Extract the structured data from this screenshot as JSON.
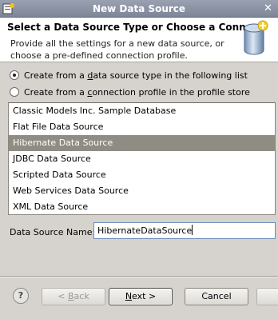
{
  "window": {
    "title": "New Data Source"
  },
  "header": {
    "title": "Select a Data Source Type or Choose a Connec",
    "description": "Provide all the settings for a new data source, or choose a pre-defined connection profile."
  },
  "options": {
    "opt1": {
      "pre": "Create from a ",
      "mnemonic": "d",
      "post": "ata source type in the following list",
      "selected": true
    },
    "opt2": {
      "pre": "Create from a ",
      "mnemonic": "c",
      "post": "onnection profile in the profile store",
      "selected": false
    }
  },
  "data_source_types": [
    "Classic Models Inc. Sample Database",
    "Flat File Data Source",
    "Hibernate Data Source",
    "JDBC Data Source",
    "Scripted Data Source",
    "Web Services Data Source",
    "XML Data Source"
  ],
  "selected_index": 2,
  "name_field": {
    "label": "Data Source Name:",
    "value": "HibernateDataSource"
  },
  "buttons": {
    "back": {
      "pre": "< ",
      "mnemonic": "B",
      "post": "ack"
    },
    "next": {
      "pre": "",
      "mnemonic": "N",
      "post": "ext >"
    },
    "cancel": {
      "label": "Cancel"
    },
    "help": {
      "label": "?"
    }
  }
}
